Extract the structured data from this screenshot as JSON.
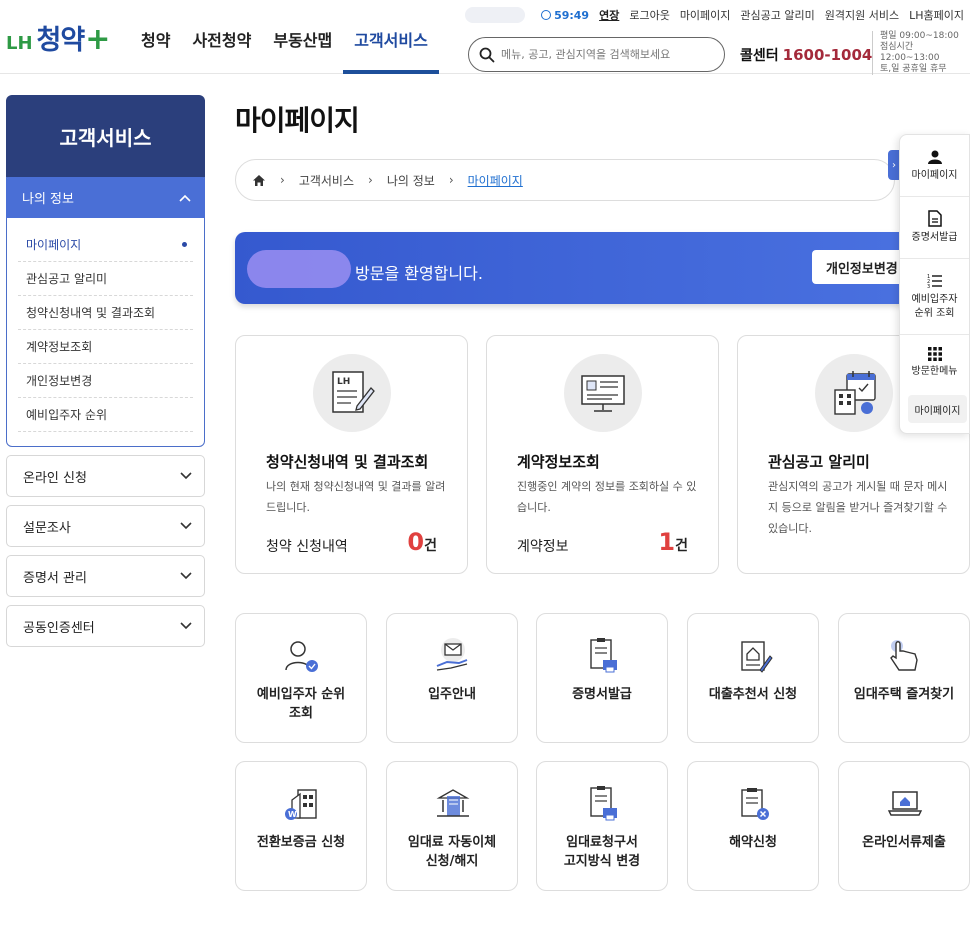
{
  "header": {
    "logo": {
      "lh": "LH",
      "main": "청약",
      "plus": "+"
    },
    "nav": [
      "청약",
      "사전청약",
      "부동산맵",
      "고객서비스"
    ],
    "util": {
      "timer": "59:49",
      "extend": "연장",
      "links": [
        "로그아웃",
        "마이페이지",
        "관심공고 알리미",
        "원격지원 서비스",
        "LH홈페이지"
      ]
    },
    "search_placeholder": "메뉴, 공고, 관심지역을 검색해보세요",
    "callcenter": {
      "label": "콜센터",
      "number": "1600-1004"
    },
    "hours": [
      "평일 09:00~18:00",
      "점심시간",
      "12:00~13:00",
      "토,일 공휴일 휴무"
    ]
  },
  "sidebar": {
    "title": "고객서비스",
    "open_group": {
      "label": "나의 정보",
      "items": [
        "마이페이지",
        "관심공고 알리미",
        "청약신청내역 및 결과조회",
        "계약정보조회",
        "개인정보변경",
        "예비입주자 순위"
      ]
    },
    "menus": [
      "온라인 신청",
      "설문조사",
      "증명서 관리",
      "공동인증센터"
    ]
  },
  "main": {
    "title": "마이페이지",
    "breadcrumb": [
      "고객서비스",
      "나의 정보",
      "마이페이지"
    ],
    "welcome": {
      "text": "방문을 환영합니다.",
      "button": "개인정보변경"
    },
    "cards": [
      {
        "title": "청약신청내역 및 결과조회",
        "desc": "나의 현재 청약신청내역 및 결과를 알려드립니다.",
        "stat_label": "청약 신청내역",
        "stat_value": "0",
        "stat_unit": "건"
      },
      {
        "title": "계약정보조회",
        "desc": "진행중인 계약의 정보를 조회하실 수 있습니다.",
        "stat_label": "계약정보",
        "stat_value": "1",
        "stat_unit": "건"
      },
      {
        "title": "관심공고 알리미",
        "desc": "관심지역의 공고가 게시될 때 문자 메시지 등으로 알림을 받거나 즐겨찾기할 수 있습니다."
      }
    ],
    "tiles": [
      {
        "l1": "예비입주자 순위",
        "l2": "조회"
      },
      {
        "l1": "입주안내",
        "l2": ""
      },
      {
        "l1": "증명서발급",
        "l2": ""
      },
      {
        "l1": "대출추천서 신청",
        "l2": ""
      },
      {
        "l1": "임대주택 즐겨찾기",
        "l2": ""
      },
      {
        "l1": "전환보증금 신청",
        "l2": ""
      },
      {
        "l1": "임대료 자동이체",
        "l2": "신청/해지"
      },
      {
        "l1": "임대료청구서",
        "l2": "고지방식 변경"
      },
      {
        "l1": "해약신청",
        "l2": ""
      },
      {
        "l1": "온라인서류제출",
        "l2": ""
      }
    ]
  },
  "quick_menu": {
    "items": [
      {
        "l1": "마이페이지",
        "l2": ""
      },
      {
        "l1": "증명서발급",
        "l2": ""
      },
      {
        "l1": "예비입주자",
        "l2": "순위 조회"
      },
      {
        "l1": "방문한메뉴",
        "l2": ""
      }
    ],
    "visited": "마이페이지"
  }
}
